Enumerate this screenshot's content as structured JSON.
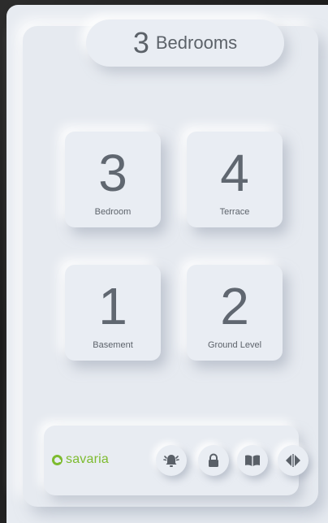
{
  "header": {
    "number": "3",
    "label": "Bedrooms"
  },
  "floors": [
    {
      "number": "3",
      "label": "Bedroom"
    },
    {
      "number": "4",
      "label": "Terrace"
    },
    {
      "number": "1",
      "label": "Basement"
    },
    {
      "number": "2",
      "label": "Ground Level"
    }
  ],
  "footer": {
    "brand": "savaria",
    "icons": [
      "bell-alarm-icon",
      "lock-icon",
      "book-icon",
      "door-arrows-icon"
    ]
  },
  "colors": {
    "background": "#e6eaf0",
    "text": "#5c6269",
    "brand": "#7dbb2f",
    "icon": "#5a6068"
  }
}
